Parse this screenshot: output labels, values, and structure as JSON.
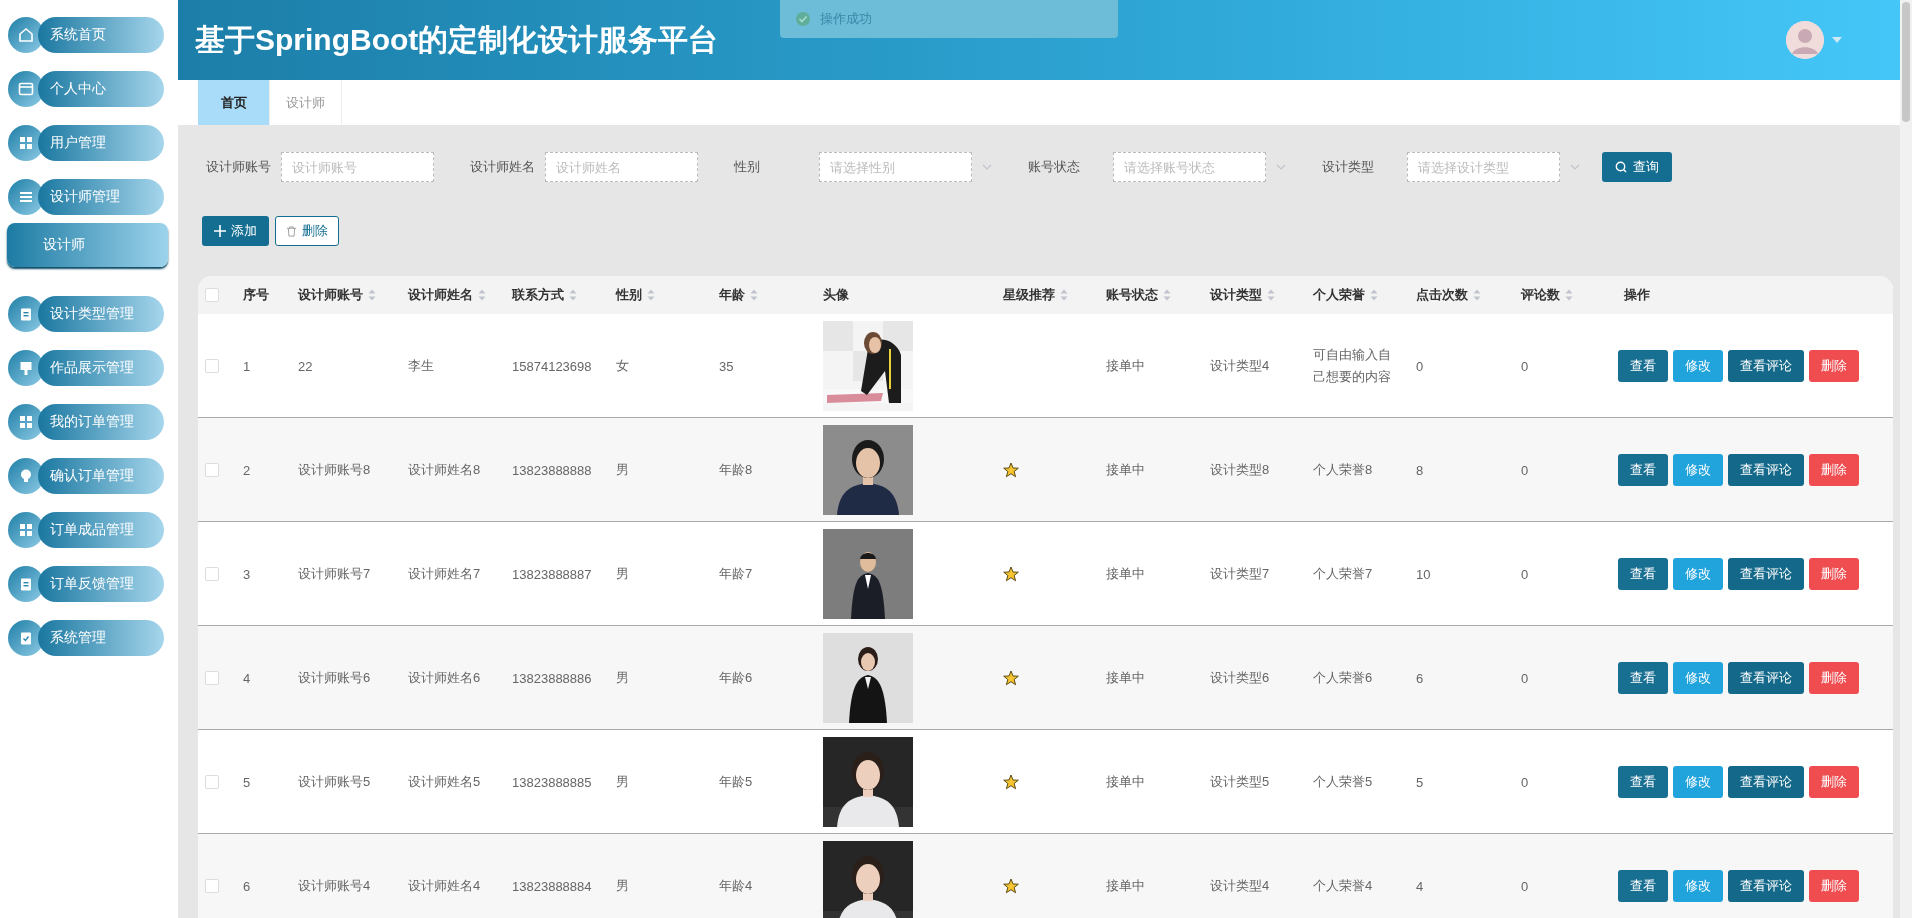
{
  "sidebar": {
    "items": [
      {
        "label": "系统首页"
      },
      {
        "label": "个人中心"
      },
      {
        "label": "用户管理"
      },
      {
        "label": "设计师管理",
        "children": [
          {
            "label": "设计师",
            "selected": true
          }
        ]
      },
      {
        "label": "设计类型管理"
      },
      {
        "label": "作品展示管理"
      },
      {
        "label": "我的订单管理"
      },
      {
        "label": "确认订单管理"
      },
      {
        "label": "订单成品管理"
      },
      {
        "label": "订单反馈管理"
      },
      {
        "label": "系统管理"
      }
    ]
  },
  "header": {
    "title": "基于SpringBoot的定制化设计服务平台"
  },
  "toast": {
    "message": "操作成功"
  },
  "tabs": [
    {
      "label": "首页",
      "selected": true
    },
    {
      "label": "设计师",
      "selected": false
    }
  ],
  "filters": [
    {
      "kind": "text",
      "label": "设计师账号",
      "placeholder": "设计师账号"
    },
    {
      "kind": "text",
      "label": "设计师姓名",
      "placeholder": "设计师姓名"
    },
    {
      "kind": "select",
      "label": "性别",
      "placeholder": "请选择性别"
    },
    {
      "kind": "select",
      "label": "账号状态",
      "placeholder": "请选择账号状态"
    },
    {
      "kind": "select",
      "label": "设计类型",
      "placeholder": "请选择设计类型"
    }
  ],
  "search_button": "查询",
  "toolbar": {
    "add": "添加",
    "delete": "删除"
  },
  "table": {
    "header_checkbox": {
      "checked": false
    },
    "columns": [
      {
        "label": "序号",
        "sortable": false
      },
      {
        "label": "设计师账号",
        "sortable": true
      },
      {
        "label": "设计师姓名",
        "sortable": true
      },
      {
        "label": "联系方式",
        "sortable": true
      },
      {
        "label": "性别",
        "sortable": true
      },
      {
        "label": "年龄",
        "sortable": true
      },
      {
        "label": "头像",
        "sortable": false
      },
      {
        "label": "星级推荐",
        "sortable": true
      },
      {
        "label": "账号状态",
        "sortable": true
      },
      {
        "label": "设计类型",
        "sortable": true
      },
      {
        "label": "个人荣誉",
        "sortable": true
      },
      {
        "label": "点击次数",
        "sortable": true
      },
      {
        "label": "评论数",
        "sortable": true
      },
      {
        "label": "操作",
        "sortable": false
      }
    ],
    "rows": [
      {
        "checked": false,
        "index": "1",
        "account": "22",
        "name": "李生",
        "phone": "15874123698",
        "gender": "女",
        "age": "35",
        "avatar": {
          "kind": "picture"
        },
        "recommended": false,
        "status": "接单中",
        "type": "设计类型4",
        "honor": "可自由输入自己想要的内容",
        "clicks": "0",
        "comments": "0",
        "actions": [
          {
            "kind": "view",
            "label": "查看"
          },
          {
            "kind": "edit",
            "label": "修改"
          },
          {
            "kind": "comments",
            "label": "查看评论"
          },
          {
            "kind": "delete",
            "label": "删除"
          }
        ]
      },
      {
        "checked": false,
        "index": "2",
        "account": "设计师账号8",
        "name": "设计师姓名8",
        "phone": "13823888888",
        "gender": "男",
        "age": "年龄8",
        "avatar": {
          "kind": "picture"
        },
        "recommended": true,
        "status": "接单中",
        "type": "设计类型8",
        "honor": "个人荣誉8",
        "clicks": "8",
        "comments": "0",
        "actions": [
          {
            "kind": "view",
            "label": "查看"
          },
          {
            "kind": "edit",
            "label": "修改"
          },
          {
            "kind": "comments",
            "label": "查看评论"
          },
          {
            "kind": "delete",
            "label": "删除"
          }
        ]
      },
      {
        "checked": false,
        "index": "3",
        "account": "设计师账号7",
        "name": "设计师姓名7",
        "phone": "13823888887",
        "gender": "男",
        "age": "年龄7",
        "avatar": {
          "kind": "picture"
        },
        "recommended": true,
        "status": "接单中",
        "type": "设计类型7",
        "honor": "个人荣誉7",
        "clicks": "10",
        "comments": "0",
        "actions": [
          {
            "kind": "view",
            "label": "查看"
          },
          {
            "kind": "edit",
            "label": "修改"
          },
          {
            "kind": "comments",
            "label": "查看评论"
          },
          {
            "kind": "delete",
            "label": "删除"
          }
        ]
      },
      {
        "checked": false,
        "index": "4",
        "account": "设计师账号6",
        "name": "设计师姓名6",
        "phone": "13823888886",
        "gender": "男",
        "age": "年龄6",
        "avatar": {
          "kind": "picture"
        },
        "recommended": true,
        "status": "接单中",
        "type": "设计类型6",
        "honor": "个人荣誉6",
        "clicks": "6",
        "comments": "0",
        "actions": [
          {
            "kind": "view",
            "label": "查看"
          },
          {
            "kind": "edit",
            "label": "修改"
          },
          {
            "kind": "comments",
            "label": "查看评论"
          },
          {
            "kind": "delete",
            "label": "删除"
          }
        ]
      },
      {
        "checked": false,
        "index": "5",
        "account": "设计师账号5",
        "name": "设计师姓名5",
        "phone": "13823888885",
        "gender": "男",
        "age": "年龄5",
        "avatar": {
          "kind": "picture"
        },
        "recommended": true,
        "status": "接单中",
        "type": "设计类型5",
        "honor": "个人荣誉5",
        "clicks": "5",
        "comments": "0",
        "actions": [
          {
            "kind": "view",
            "label": "查看"
          },
          {
            "kind": "edit",
            "label": "修改"
          },
          {
            "kind": "comments",
            "label": "查看评论"
          },
          {
            "kind": "delete",
            "label": "删除"
          }
        ]
      },
      {
        "checked": false,
        "index": "6",
        "account": "设计师账号4",
        "name": "设计师姓名4",
        "phone": "13823888884",
        "gender": "男",
        "age": "年龄4",
        "avatar": {
          "kind": "picture"
        },
        "recommended": true,
        "status": "接单中",
        "type": "设计类型4",
        "honor": "个人荣誉4",
        "clicks": "4",
        "comments": "0",
        "actions": [
          {
            "kind": "view",
            "label": "查看"
          },
          {
            "kind": "edit",
            "label": "修改"
          },
          {
            "kind": "comments",
            "label": "查看评论"
          },
          {
            "kind": "delete",
            "label": "删除"
          }
        ]
      }
    ]
  }
}
